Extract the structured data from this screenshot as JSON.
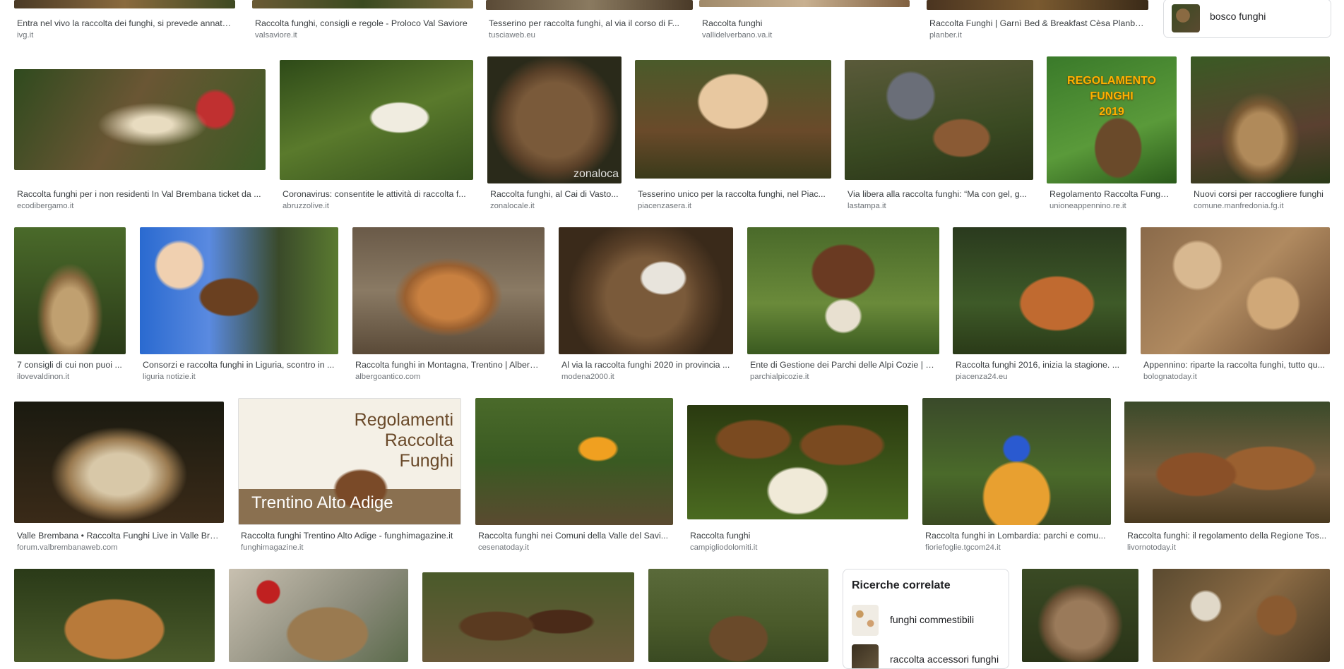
{
  "colors": {
    "caption": "#3c4043",
    "source": "#70757a",
    "border": "#dadce0"
  },
  "top_row": [
    {
      "caption": "Entra nel vivo la raccolta dei funghi, si prevede annata ...",
      "source": "ivg.it"
    },
    {
      "caption": "Raccolta funghi, consigli e regole - Proloco Val Saviore",
      "source": "valsaviore.it"
    },
    {
      "caption": "Tesserino per raccolta funghi, al via il corso di F...",
      "source": "tusciaweb.eu"
    },
    {
      "caption": "Raccolta funghi",
      "source": "vallidelverbano.va.it"
    },
    {
      "caption": "Raccolta Funghi | Garnì Bed & Breakfast Cèsa Planber ...",
      "source": "planber.it"
    }
  ],
  "suggestion_chip": {
    "label": "bosco funghi"
  },
  "row1": [
    {
      "caption": "Raccolta funghi per i non residenti In Val Brembana ticket da ...",
      "source": "ecodibergamo.it"
    },
    {
      "caption": "Coronavirus: consentite le attività di raccolta f...",
      "source": "abruzzolive.it"
    },
    {
      "caption": "Raccolta funghi, al Cai di Vasto...",
      "source": "zonalocale.it",
      "watermark": "zonaloca"
    },
    {
      "caption": "Tesserino unico per la raccolta funghi, nel Piac...",
      "source": "piacenzasera.it"
    },
    {
      "caption": "Via libera alla raccolta funghi: “Ma con gel, g...",
      "source": "lastampa.it"
    },
    {
      "caption": "Regolamento Raccolta Funghi...",
      "source": "unioneappennino.re.it",
      "overlay": [
        "REGOLAMENTO",
        "FUNGHI",
        "2019"
      ]
    },
    {
      "caption": "Nuovi corsi per raccogliere funghi",
      "source": "comune.manfredonia.fg.it"
    }
  ],
  "row2": [
    {
      "caption": "7 consigli di cui non puoi ...",
      "source": "ilovevaldinon.it"
    },
    {
      "caption": "Consorzi e raccolta funghi in Liguria, scontro in ...",
      "source": "liguria notizie.it"
    },
    {
      "caption": "Raccolta funghi in Montagna, Trentino | Alberg...",
      "source": "albergoantico.com"
    },
    {
      "caption": "Al via la raccolta funghi 2020 in provincia ...",
      "source": "modena2000.it"
    },
    {
      "caption": "Ente di Gestione dei Parchi delle Alpi Cozie | R...",
      "source": "parchialpicozie.it"
    },
    {
      "caption": "Raccolta funghi 2016, inizia la stagione. ...",
      "source": "piacenza24.eu"
    },
    {
      "caption": "Appennino: riparte la raccolta funghi, tutto qu...",
      "source": "bolognatoday.it"
    }
  ],
  "row3": [
    {
      "caption": "Valle Brembana • Raccolta Funghi Live in Valle Bre...",
      "source": "forum.valbrembanaweb.com"
    },
    {
      "caption": "Raccolta funghi Trentino Alto Adige - funghimagazine.it",
      "source": "funghimagazine.it",
      "poster_title": [
        "Regolamenti",
        "Raccolta",
        "Funghi"
      ],
      "poster_band": "Trentino Alto Adige"
    },
    {
      "caption": "Raccolta funghi nei Comuni della Valle del Savi...",
      "source": "cesenatoday.it"
    },
    {
      "caption": "Raccolta funghi",
      "source": "campigliodolomiti.it"
    },
    {
      "caption": "Raccolta funghi in Lombardia: parchi e comu...",
      "source": "fioriefoglie.tgcom24.it"
    },
    {
      "caption": "Raccolta funghi: il regolamento della Regione Tos...",
      "source": "livornotoday.it"
    }
  ],
  "related": {
    "title": "Ricerche correlate",
    "items": [
      {
        "label": "funghi commestibili"
      },
      {
        "label": "raccolta accessori funghi"
      }
    ]
  }
}
